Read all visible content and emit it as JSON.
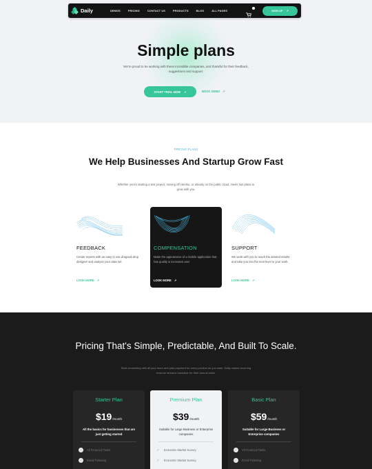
{
  "nav": {
    "logo": "Daily",
    "menu": [
      "DEMOS",
      "PRICING",
      "CONTACT US",
      "PRODUCTS",
      "BLOG",
      "ALL PAGES"
    ],
    "signup": "SIGN UP",
    "icons": {
      "cart": "cart-icon",
      "arrow": "arrow-up-right-icon"
    }
  },
  "hero": {
    "title": "Simple plans",
    "subtitle": "We're proud to be working with these incredible companies, and thankful for their feedback, suggestions and support.",
    "trial": "START TRIAL NOW",
    "demo": "BOOK DEMO",
    "arrow": "↗"
  },
  "features": {
    "eyebrow": "PRICING PLANS",
    "title": "We Help Businesses And Startup Grow Fast",
    "subtitle": "Whether you're starting a test project, moving off Heroku, or already on the public cloud, Heels has plans to grow with you.",
    "items": [
      {
        "title": "FEEDBACK",
        "text": "Create reports with an easy to use dragand-drop designer and analyze your data set.",
        "link": "LOOK MORE"
      },
      {
        "title": "COMPENSATION",
        "text": "Make the appearance of a mobile application that has quality & increases user",
        "link": "LOOK MORE"
      },
      {
        "title": "SUPPORT",
        "text": "We work with you to reach the desired results and take you into the next level in your work.",
        "link": "LOOK MORE"
      }
    ]
  },
  "pricing": {
    "title": "Pricing That's Simple, Predictable, And Built To Scale.",
    "subtitle": "Start connecting with all your team and plan payment for every product as you want. Daily makes recurring revenue streams trackable for their annual value.",
    "plans": [
      {
        "name": "Starter Plan",
        "price": "$19",
        "per": "/month",
        "desc": "All the basics for businesses that are just getting started",
        "features": [
          "All Financial Tasks",
          "Email Ticketing"
        ]
      },
      {
        "name": "Premium Plan",
        "price": "$39",
        "per": "/month",
        "desc": "Suitable for Large Business or Enterprise companies",
        "features": [
          "Economic Market Survey",
          "Economic Market Survey"
        ]
      },
      {
        "name": "Basic Plan",
        "price": "$59",
        "per": "/month",
        "desc": "Suitable for Large Business or Enterprise companies",
        "features": [
          "All Financial Tasks",
          "Email Ticketing"
        ]
      }
    ]
  },
  "colors": {
    "accent": "#37c59a",
    "dark": "#1b1b1b",
    "link": "#5bb4e6"
  }
}
